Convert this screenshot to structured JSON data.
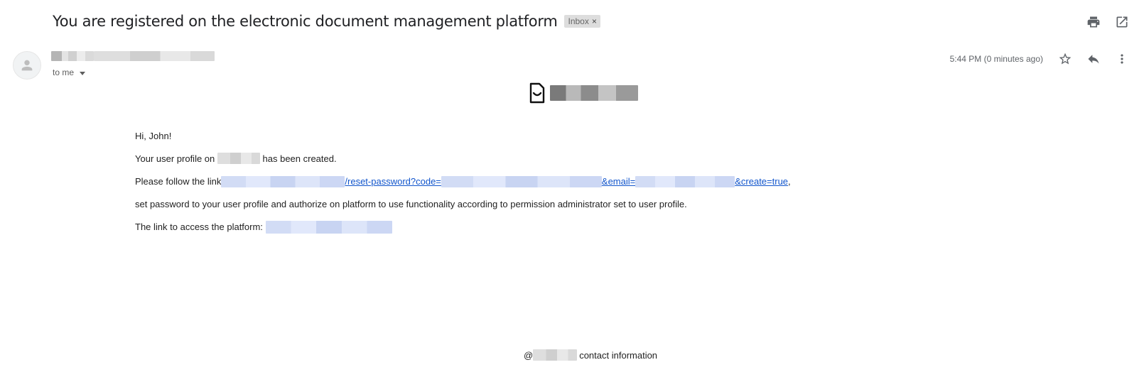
{
  "email": {
    "subject": "You are registered on the electronic document management platform",
    "label": {
      "name": "Inbox",
      "remove": "×"
    },
    "recipient": "to me",
    "timestamp": "5:44 PM (0 minutes ago)",
    "greeting": "Hi, John!",
    "line1": {
      "before": "Your user profile on",
      "after": "has been created."
    },
    "line2": {
      "before": "Please follow the link",
      "link_reset": "/reset-password?code=",
      "link_email": "&email=",
      "link_create": "&create=true",
      "after": ","
    },
    "line3": "set password to your user profile and authorize on platform to use functionality according to permission administrator set to user profile.",
    "line4": "The link to access the platform:",
    "footer": {
      "at": "@",
      "text": "contact information"
    }
  },
  "icons": {
    "print": "print-icon",
    "open_new_window": "open-in-new-window-icon",
    "star": "star-icon",
    "reply": "reply-icon",
    "more": "more-vertical-icon",
    "avatar": "person-icon",
    "brand": "document-smile-icon"
  }
}
